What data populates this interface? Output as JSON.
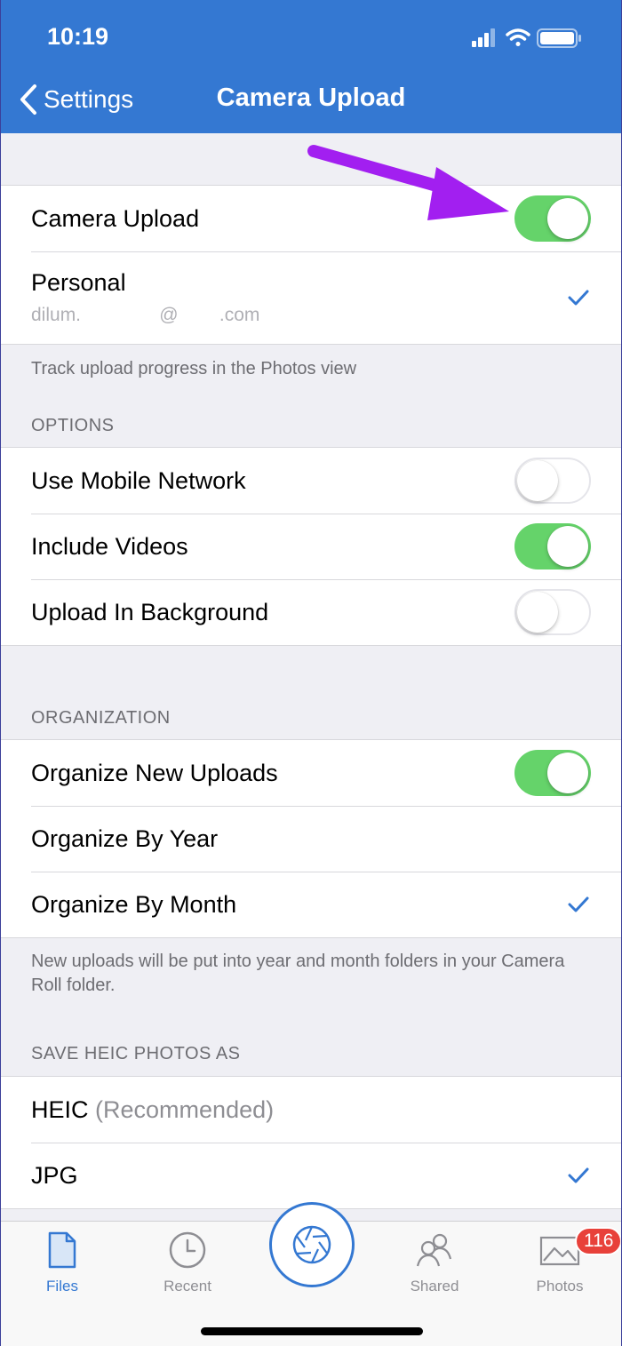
{
  "status_bar": {
    "time": "10:19"
  },
  "nav": {
    "back_label": "Settings",
    "title": "Camera Upload"
  },
  "camera_upload": {
    "label": "Camera Upload",
    "enabled": true,
    "account_name": "Personal",
    "account_email": "dilum.                     @           .com",
    "footnote": "Track upload progress in the Photos view"
  },
  "options": {
    "header": "OPTIONS",
    "items": [
      {
        "label": "Use Mobile Network",
        "enabled": false
      },
      {
        "label": "Include Videos",
        "enabled": true
      },
      {
        "label": "Upload In Background",
        "enabled": false
      }
    ]
  },
  "organization": {
    "header": "ORGANIZATION",
    "new_uploads": {
      "label": "Organize New Uploads",
      "enabled": true
    },
    "by_year": "Organize By Year",
    "by_month": "Organize By Month",
    "footnote": "New uploads will be put into year and month folders in your Camera Roll folder."
  },
  "heic": {
    "header": "SAVE HEIC PHOTOS AS",
    "heic_label": "HEIC",
    "heic_note": "(Recommended)",
    "jpg_label": "JPG"
  },
  "tabbar": {
    "files": "Files",
    "recent": "Recent",
    "shared": "Shared",
    "photos": "Photos",
    "photos_badge": "116"
  },
  "colors": {
    "accent": "#3478d2",
    "toggle_on": "#65d36a",
    "annotation": "#a21ff0",
    "badge": "#e8413a"
  }
}
